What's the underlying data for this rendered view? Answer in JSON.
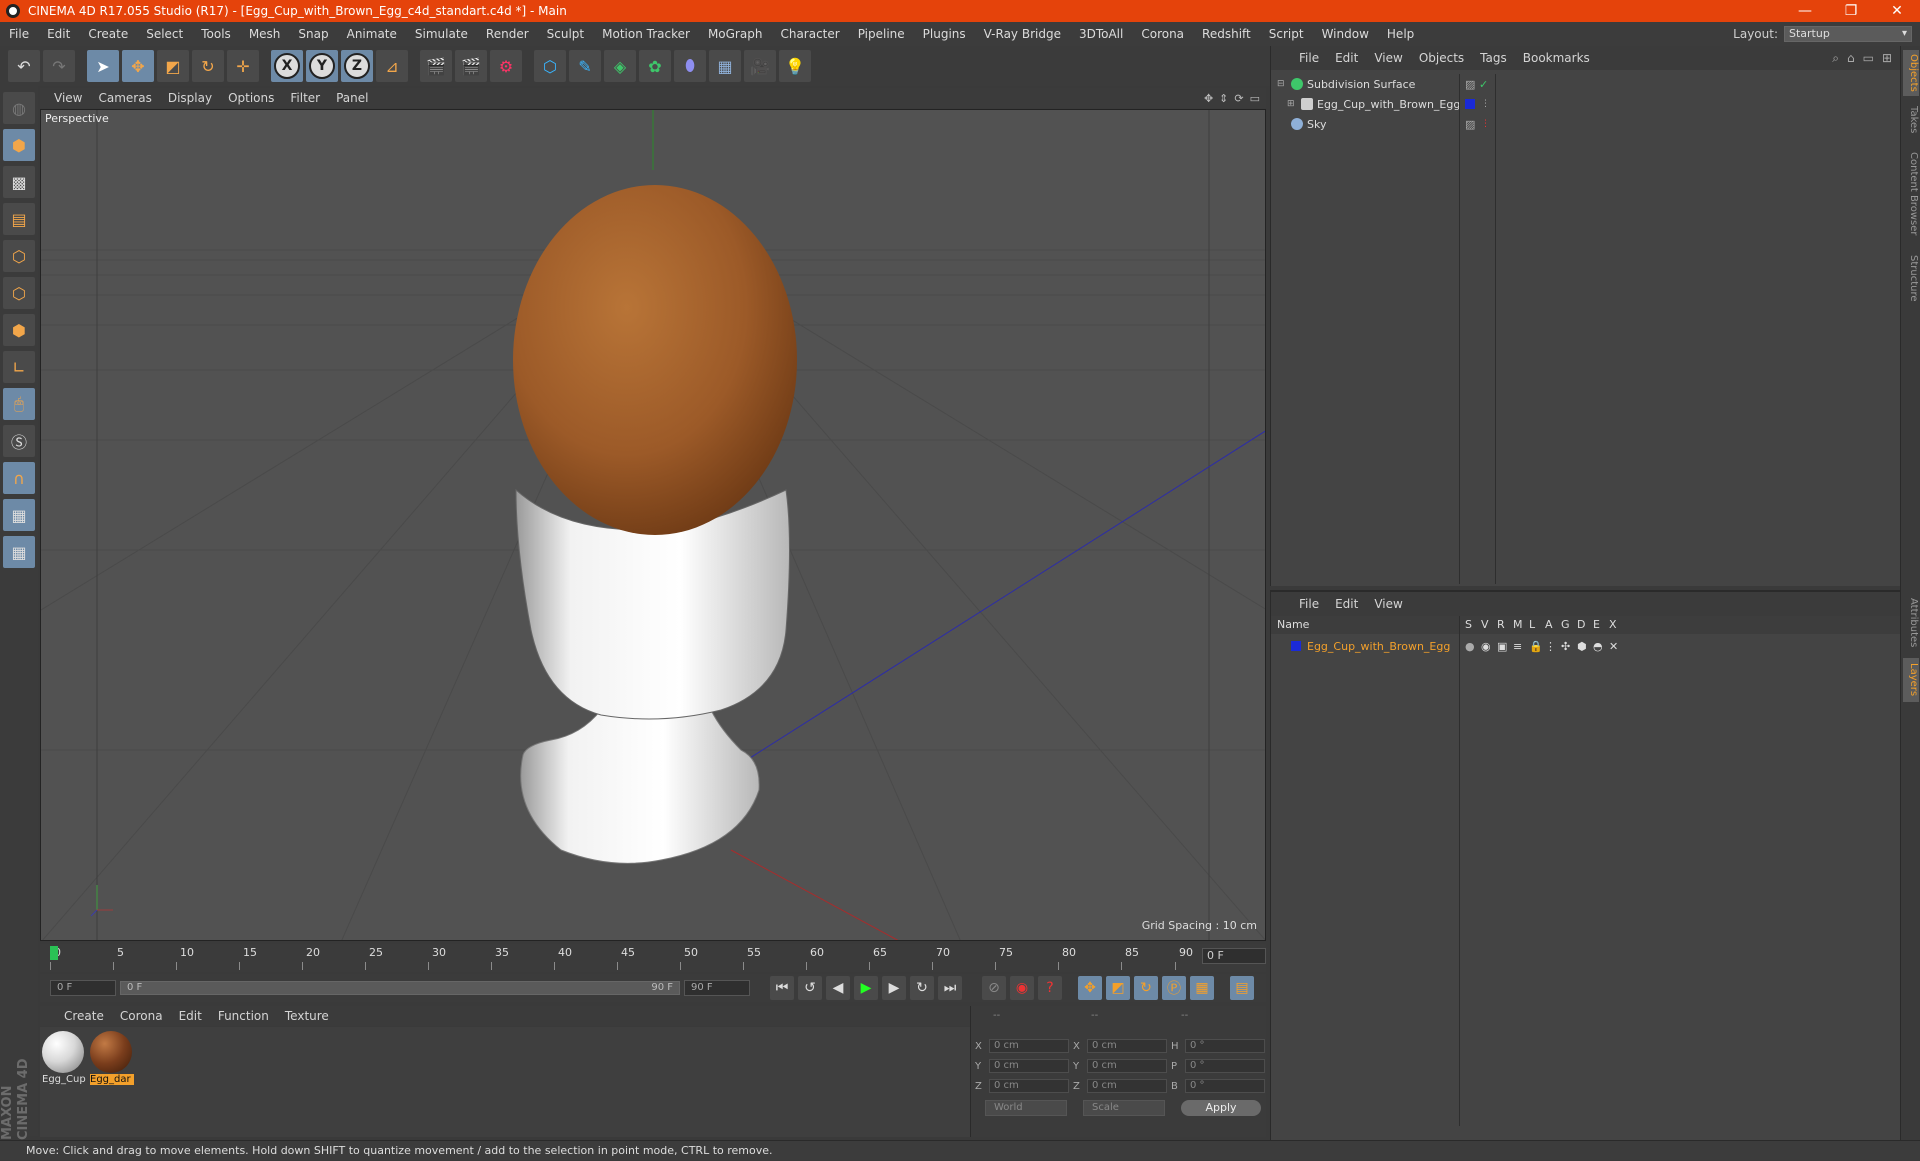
{
  "window": {
    "title": "CINEMA 4D R17.055 Studio (R17) - [Egg_Cup_with_Brown_Egg_c4d_standart.c4d *] - Main",
    "minimize": "—",
    "restore": "❐",
    "close": "✕"
  },
  "menubar": {
    "items": [
      "File",
      "Edit",
      "Create",
      "Select",
      "Tools",
      "Mesh",
      "Snap",
      "Animate",
      "Simulate",
      "Render",
      "Sculpt",
      "Motion Tracker",
      "MoGraph",
      "Character",
      "Pipeline",
      "Plugins",
      "V-Ray Bridge",
      "3DToAll",
      "Corona",
      "Redshift",
      "Script",
      "Window",
      "Help"
    ],
    "layout_label": "Layout:",
    "layout_value": "Startup"
  },
  "viewport": {
    "menu": [
      "View",
      "Cameras",
      "Display",
      "Options",
      "Filter",
      "Panel"
    ],
    "label": "Perspective",
    "grid_spacing": "Grid Spacing : 10 cm"
  },
  "timeline": {
    "ticks": [
      "0",
      "5",
      "10",
      "15",
      "20",
      "25",
      "30",
      "35",
      "40",
      "45",
      "50",
      "55",
      "60",
      "65",
      "70",
      "75",
      "80",
      "85",
      "90"
    ],
    "current_frame": "0 F"
  },
  "transport": {
    "start_field": "0 F",
    "range_start": "0 F",
    "range_end": "90 F",
    "end_field": "90 F"
  },
  "materials": {
    "menu": [
      "Create",
      "Corona",
      "Edit",
      "Function",
      "Texture"
    ],
    "items": [
      {
        "label": "Egg_Cup",
        "color": "#d8d8d8"
      },
      {
        "label": "Egg_dar",
        "color": "#7a3d1c"
      }
    ]
  },
  "coords": {
    "headers": [
      "--",
      "--",
      "--"
    ],
    "rows": [
      {
        "a1": "X",
        "v1": "0 cm",
        "a2": "X",
        "v2": "0 cm",
        "a3": "H",
        "v3": "0 °"
      },
      {
        "a1": "Y",
        "v1": "0 cm",
        "a2": "Y",
        "v2": "0 cm",
        "a3": "P",
        "v3": "0 °"
      },
      {
        "a1": "Z",
        "v1": "0 cm",
        "a2": "Z",
        "v2": "0 cm",
        "a3": "B",
        "v3": "0 °"
      }
    ],
    "space": "World",
    "mode": "Scale",
    "apply": "Apply"
  },
  "objects": {
    "menu": [
      "File",
      "Edit",
      "View",
      "Objects",
      "Tags",
      "Bookmarks"
    ],
    "tree": [
      {
        "name": "Subdivision Surface",
        "icon_color": "#3ec76a"
      },
      {
        "name": "Egg_Cup_with_Brown_Egg",
        "icon_color": "#cfcfcf"
      },
      {
        "name": "Sky",
        "icon_color": "#8fb0d8"
      }
    ]
  },
  "layers": {
    "menu": [
      "File",
      "Edit",
      "View"
    ],
    "header": {
      "name": "Name",
      "cols": [
        "S",
        "V",
        "R",
        "M",
        "L",
        "A",
        "G",
        "D",
        "E",
        "X"
      ]
    },
    "rows": [
      {
        "name": "Egg_Cup_with_Brown_Egg"
      }
    ]
  },
  "sidetabs": [
    "Objects",
    "Takes",
    "Content Browser",
    "Structure",
    "Attributes",
    "Layers"
  ],
  "status": "Move: Click and drag to move elements. Hold down SHIFT to quantize movement / add to the selection in point mode, CTRL to remove.",
  "logo": {
    "line1": "MAXON",
    "line2": "CINEMA 4D"
  },
  "colors": {
    "title_bar": "#e5430b",
    "accent": "#f3a02b",
    "egg": "#a7642e",
    "cup": "#e8e8e8"
  }
}
